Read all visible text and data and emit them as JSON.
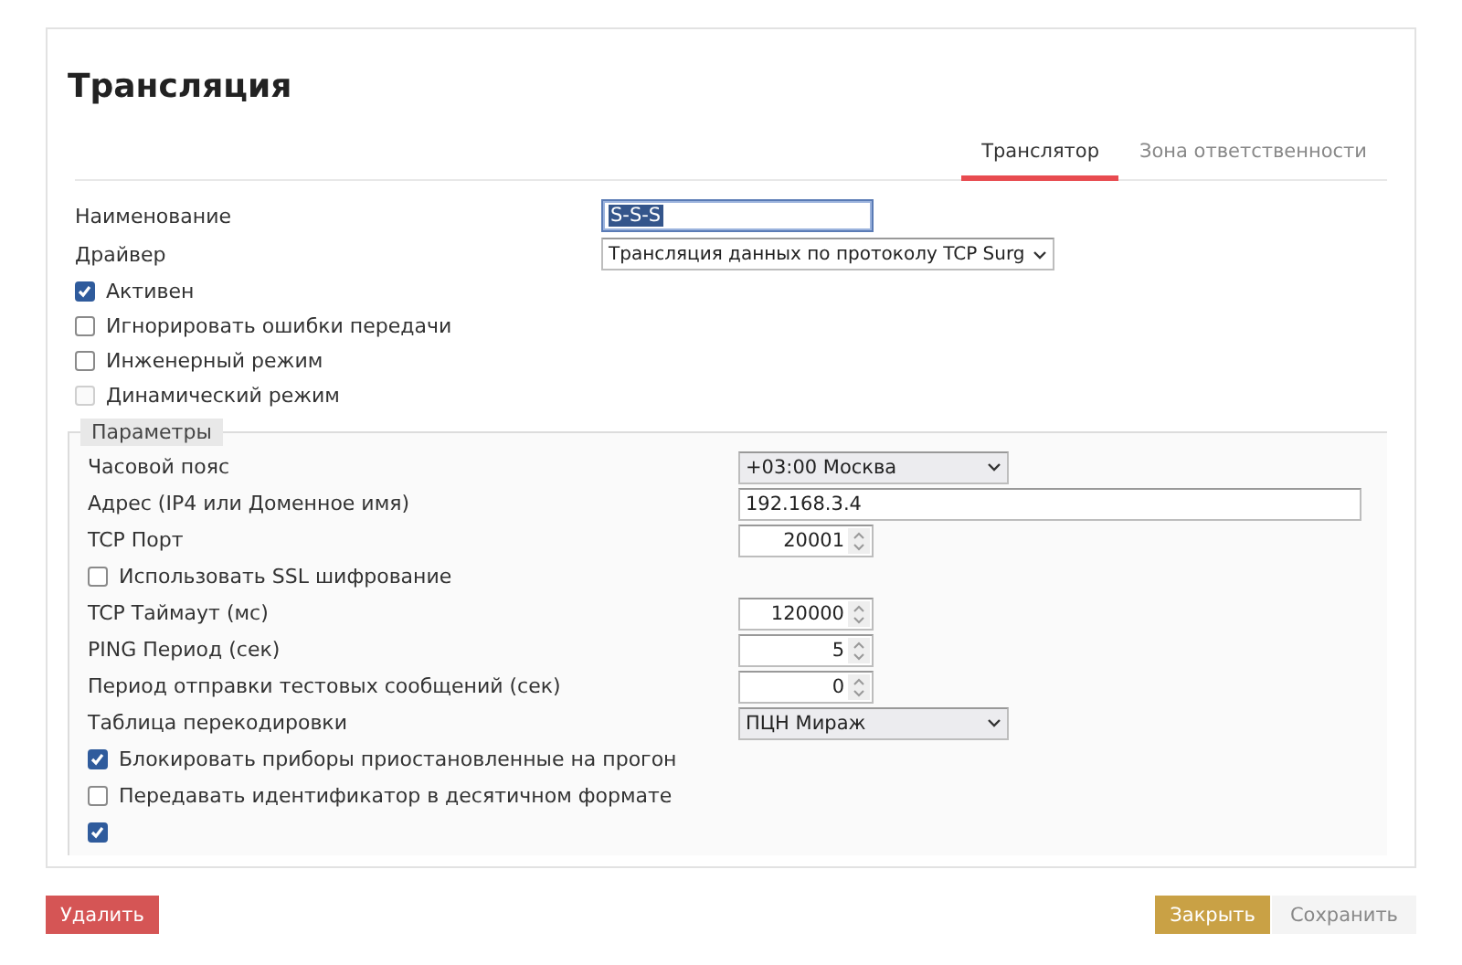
{
  "title": "Трансляция",
  "tabs": [
    {
      "label": "Транслятор",
      "selected": true
    },
    {
      "label": "Зона ответственности",
      "selected": false
    }
  ],
  "fields": [
    {
      "kind": "text",
      "label": "Наименование",
      "value": "S-S-S",
      "focused": true
    },
    {
      "kind": "select",
      "label": "Драйвер",
      "value": "Трансляция данных по протоколу TCP Surg"
    },
    {
      "kind": "checkbox",
      "label": "Активен",
      "checked": true,
      "disabled": false
    },
    {
      "kind": "checkbox",
      "label": "Игнорировать ошибки передачи",
      "checked": false,
      "disabled": false
    },
    {
      "kind": "checkbox",
      "label": "Инженерный режим",
      "checked": false,
      "disabled": false
    },
    {
      "kind": "checkbox",
      "label": "Динамический режим",
      "checked": false,
      "disabled": true
    }
  ],
  "parameters": {
    "legend": "Параметры",
    "rows": [
      {
        "kind": "select",
        "label": "Часовой пояс",
        "value": "+03:00 Москва"
      },
      {
        "kind": "wide-text",
        "label": "Адрес (IP4 или Доменное имя)",
        "value": "192.168.3.4"
      },
      {
        "kind": "number",
        "label": "TCP Порт",
        "value": "20001"
      },
      {
        "kind": "checkbox",
        "label": "Использовать SSL шифрование",
        "checked": false
      },
      {
        "kind": "number",
        "label": "TCP Таймаут (мс)",
        "value": "120000"
      },
      {
        "kind": "number",
        "label": "PING Период (сек)",
        "value": "5"
      },
      {
        "kind": "number",
        "label": "Период отправки тестовых сообщений (сек)",
        "value": "0"
      },
      {
        "kind": "select",
        "label": "Таблица перекодировки",
        "value": "ПЦН Мираж"
      },
      {
        "kind": "checkbox",
        "label": "Блокировать приборы приостановленные на прогон",
        "checked": true
      },
      {
        "kind": "checkbox",
        "label": "Передавать идентификатор в десятичном формате",
        "checked": false
      },
      {
        "kind": "checkbox",
        "checked": true
      }
    ]
  },
  "buttons": [
    {
      "kind": "danger",
      "label": "Удалить"
    },
    {
      "kind": "primary",
      "label": "Закрыть"
    },
    {
      "kind": "default",
      "label": "Сохранить"
    }
  ]
}
